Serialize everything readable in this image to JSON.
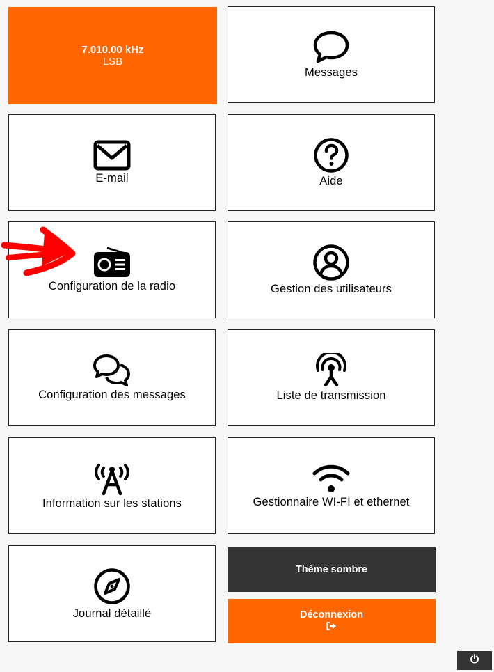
{
  "frequency": {
    "value": "7.010.00 kHz",
    "mode": "LSB"
  },
  "tiles": {
    "messages": "Messages",
    "email": "E-mail",
    "aide": "Aide",
    "radio_config": "Configuration de la radio",
    "users": "Gestion des utilisateurs",
    "messages_config": "Configuration des messages",
    "transmission": "Liste de transmission",
    "stations": "Information sur les stations",
    "wifi": "Gestionnaire WI-FI et ethernet",
    "journal": "Journal détaillé"
  },
  "buttons": {
    "dark_theme": "Thème sombre",
    "logout": "Déconnexion"
  },
  "icons": {
    "messages": "speech-bubble-icon",
    "email": "envelope-icon",
    "aide": "question-circle-icon",
    "radio_config": "radio-icon",
    "users": "user-circle-icon",
    "messages_config": "comments-icon",
    "transmission": "broadcast-tower-icon",
    "stations": "antenna-icon",
    "wifi": "wifi-icon",
    "journal": "compass-icon",
    "logout": "sign-out-icon",
    "power": "power-icon"
  },
  "colors": {
    "accent": "#ff6600",
    "dark": "#333333",
    "annotation": "#ff0000"
  }
}
